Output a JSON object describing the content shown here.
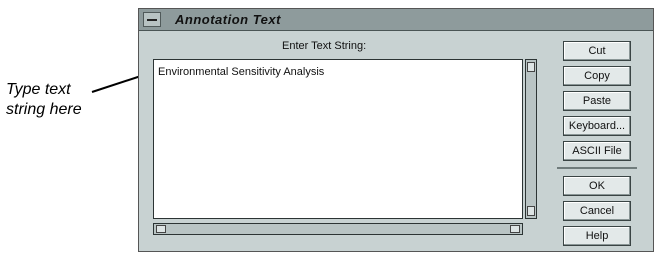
{
  "callout": {
    "text_line1": "Type text",
    "text_line2": "string here"
  },
  "window": {
    "title": "Annotation Text",
    "prompt": "Enter Text String:",
    "text_value": "Environmental Sensitivity Analysis",
    "buttons": {
      "cut": "Cut",
      "copy": "Copy",
      "paste": "Paste",
      "keyboard": "Keyboard...",
      "ascii_file": "ASCII File",
      "ok": "OK",
      "cancel": "Cancel",
      "help": "Help"
    }
  }
}
